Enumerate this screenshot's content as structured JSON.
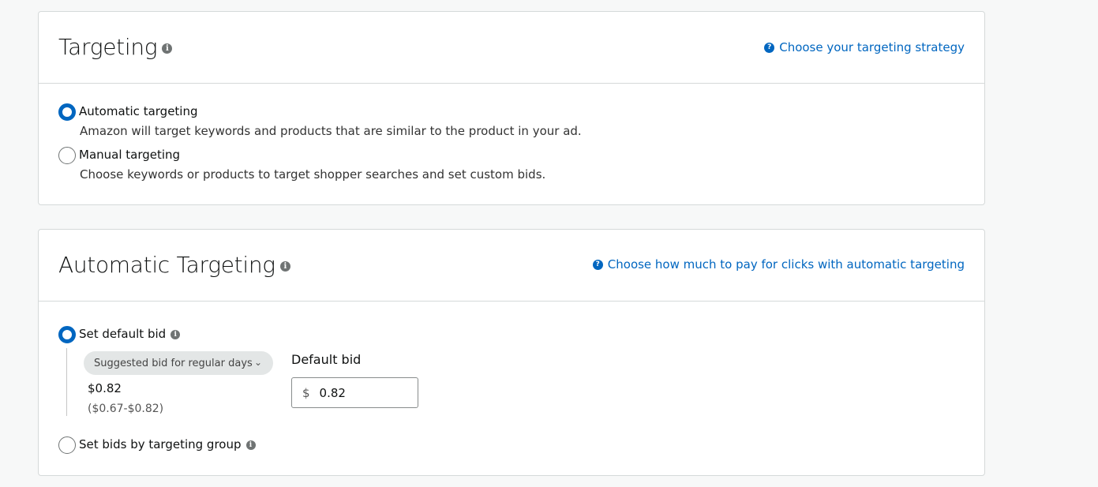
{
  "targeting": {
    "title": "Targeting",
    "help_link": "Choose your targeting strategy",
    "options": [
      {
        "label": "Automatic targeting",
        "description": "Amazon will target keywords and products that are similar to the product in your ad.",
        "checked": true
      },
      {
        "label": "Manual targeting",
        "description": "Choose keywords or products to target shopper searches and set custom bids.",
        "checked": false
      }
    ]
  },
  "automatic_targeting": {
    "title": "Automatic Targeting",
    "help_link": "Choose how much to pay for clicks with automatic targeting",
    "options": [
      {
        "label": "Set default bid",
        "checked": true
      },
      {
        "label": "Set bids by targeting group",
        "checked": false
      }
    ],
    "suggested_select": "Suggested bid for regular days",
    "suggested_value": "$0.82",
    "suggested_range": "($0.67-$0.82)",
    "default_bid_label": "Default bid",
    "currency": "$",
    "default_bid_value": "0.82"
  },
  "icons": {
    "info": "info-icon",
    "help": "question-icon",
    "dropdown": "chevron-down-icon"
  },
  "colors": {
    "link": "#0066c0",
    "radio_checked": "#0066c0",
    "border": "#d5d9d9"
  }
}
